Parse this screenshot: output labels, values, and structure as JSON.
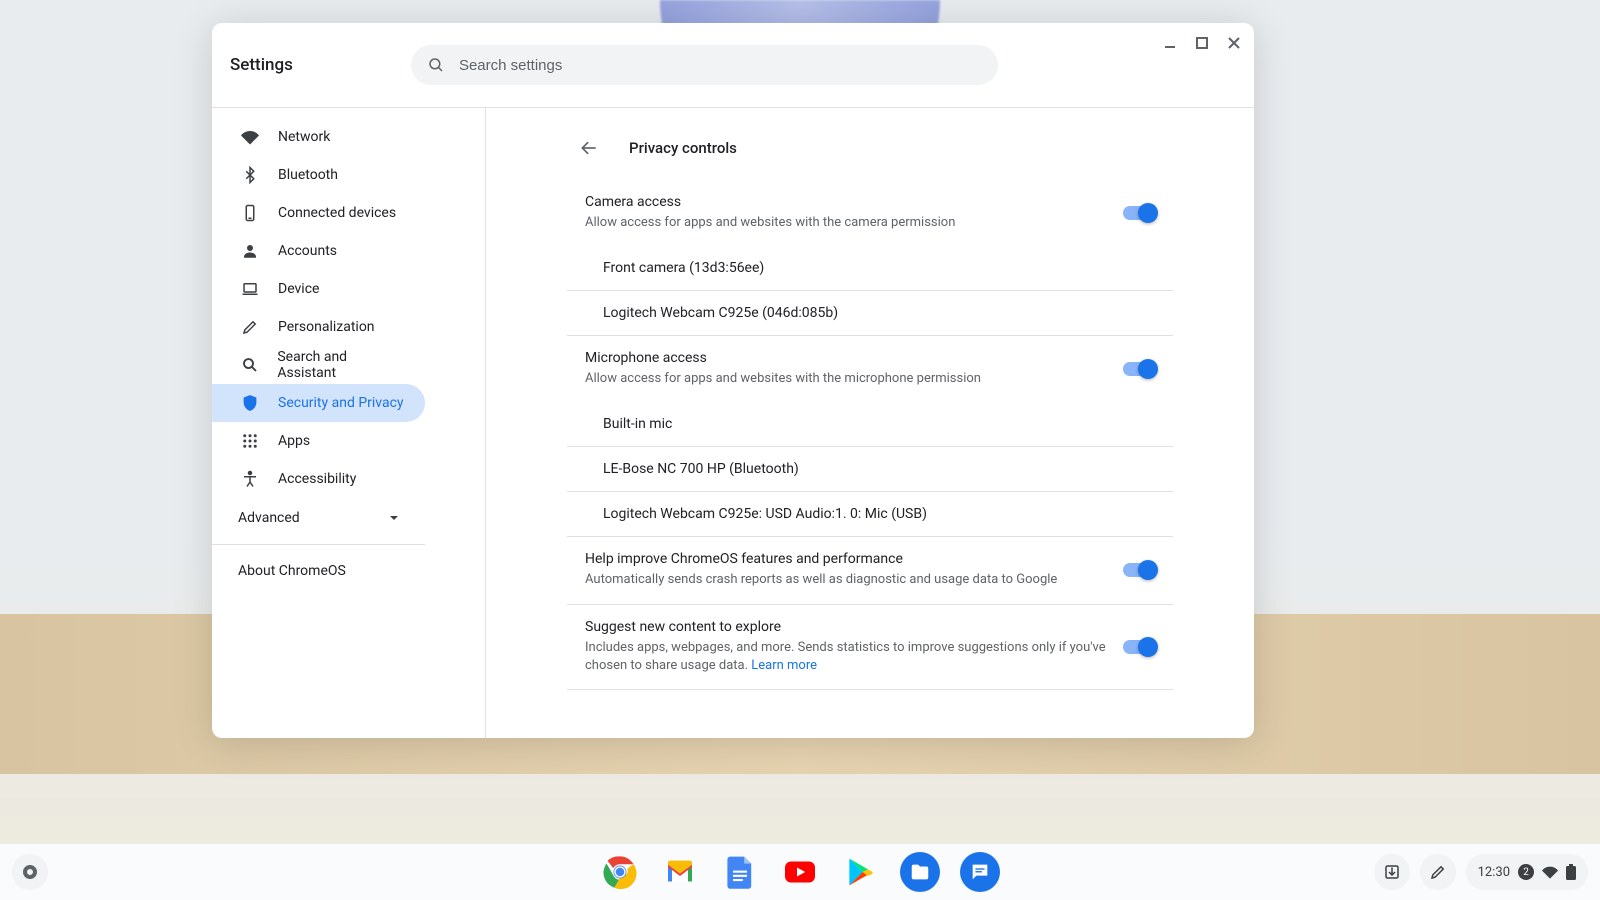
{
  "window": {
    "title": "Settings",
    "search_placeholder": "Search settings"
  },
  "sidebar": {
    "items": [
      {
        "icon": "wifi",
        "label": "Network"
      },
      {
        "icon": "bluetooth",
        "label": "Bluetooth"
      },
      {
        "icon": "devices",
        "label": "Connected devices"
      },
      {
        "icon": "person",
        "label": "Accounts"
      },
      {
        "icon": "laptop",
        "label": "Device"
      },
      {
        "icon": "edit",
        "label": "Personalization"
      },
      {
        "icon": "search",
        "label": "Search and Assistant"
      },
      {
        "icon": "shield",
        "label": "Security and Privacy"
      },
      {
        "icon": "apps",
        "label": "Apps"
      },
      {
        "icon": "accessibility",
        "label": "Accessibility"
      }
    ],
    "advanced_label": "Advanced",
    "about_label": "About ChromeOS",
    "active_index": 7
  },
  "page": {
    "title": "Privacy controls",
    "camera": {
      "title": "Camera access",
      "sub": "Allow access for apps and websites with the camera permission",
      "enabled": true,
      "devices": [
        "Front camera (13d3:56ee)",
        "Logitech Webcam C925e (046d:085b)"
      ]
    },
    "mic": {
      "title": "Microphone access",
      "sub": "Allow access for apps and websites with the microphone permission",
      "enabled": true,
      "devices": [
        "Built-in mic",
        "LE-Bose NC 700 HP (Bluetooth)",
        "Logitech Webcam C925e: USD Audio:1. 0: Mic (USB)"
      ]
    },
    "improve": {
      "title": "Help improve ChromeOS features and performance",
      "sub": "Automatically sends crash reports as well as diagnostic and usage data to Google",
      "enabled": true
    },
    "suggest": {
      "title": "Suggest new content to explore",
      "sub": "Includes apps, webpages, and more. Sends statistics to improve suggestions only if you've chosen to share usage data. ",
      "learn_more": "Learn more",
      "enabled": true
    }
  },
  "shelf": {
    "clock": "12:30",
    "notification_count": "2"
  }
}
